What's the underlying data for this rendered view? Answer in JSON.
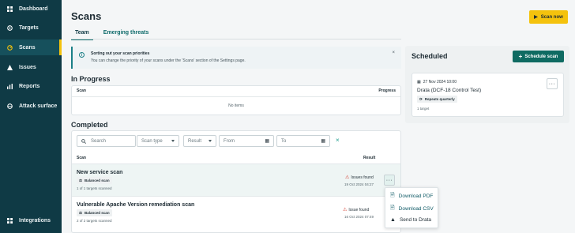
{
  "sidebar": {
    "items": [
      {
        "label": "Dashboard",
        "icon": "grid-icon"
      },
      {
        "label": "Targets",
        "icon": "target-icon"
      },
      {
        "label": "Scans",
        "icon": "scan-icon"
      },
      {
        "label": "Issues",
        "icon": "warning-icon"
      },
      {
        "label": "Reports",
        "icon": "chart-icon"
      },
      {
        "label": "Attack surface",
        "icon": "globe-icon"
      }
    ],
    "integrations": "Integrations"
  },
  "header": {
    "title": "Scans",
    "scan_now": "Scan now"
  },
  "tabs": [
    "Team",
    "Emerging threats"
  ],
  "banner": {
    "title": "Sorting out your scan priorities",
    "body": "You can change the priority of your scans under the 'Scans' section of the Settings page.",
    "close": "×"
  },
  "in_progress": {
    "title": "In Progress",
    "col_scan": "Scan",
    "col_progress": "Progress",
    "empty": "No items"
  },
  "completed": {
    "title": "Completed",
    "search_placeholder": "Search",
    "scan_type": "Scan type",
    "result": "Result",
    "from": "From",
    "to": "To",
    "clear": "×",
    "col_scan": "Scan",
    "col_result": "Result",
    "rows": [
      {
        "name": "New service scan",
        "chip": "Balanced scan",
        "targets": "1 of 1 targets scanned",
        "issue": "Issues found",
        "date": "19 Oct 2024 04:27"
      },
      {
        "name": "Vulnerable Apache Version remediation scan",
        "chip": "Balanced scan",
        "targets": "2 of 2 targets scanned",
        "issue": "Issue found",
        "date": "16 Oct 2024 07:49"
      }
    ],
    "menu": [
      "Download PDF",
      "Download CSV",
      "Send to Drata"
    ]
  },
  "scheduled": {
    "title": "Scheduled",
    "button": "Schedule scan",
    "card": {
      "date": "27 Nov 2024 10:00",
      "name": "Drata (DCF-18 Control Test)",
      "repeat": "Repeats quarterly",
      "targets": "1 target"
    }
  },
  "colors": {
    "sidebar": "#0f3a45",
    "accent": "#f4c20d",
    "teal": "#0f6b62",
    "warning": "#d33a2c"
  }
}
